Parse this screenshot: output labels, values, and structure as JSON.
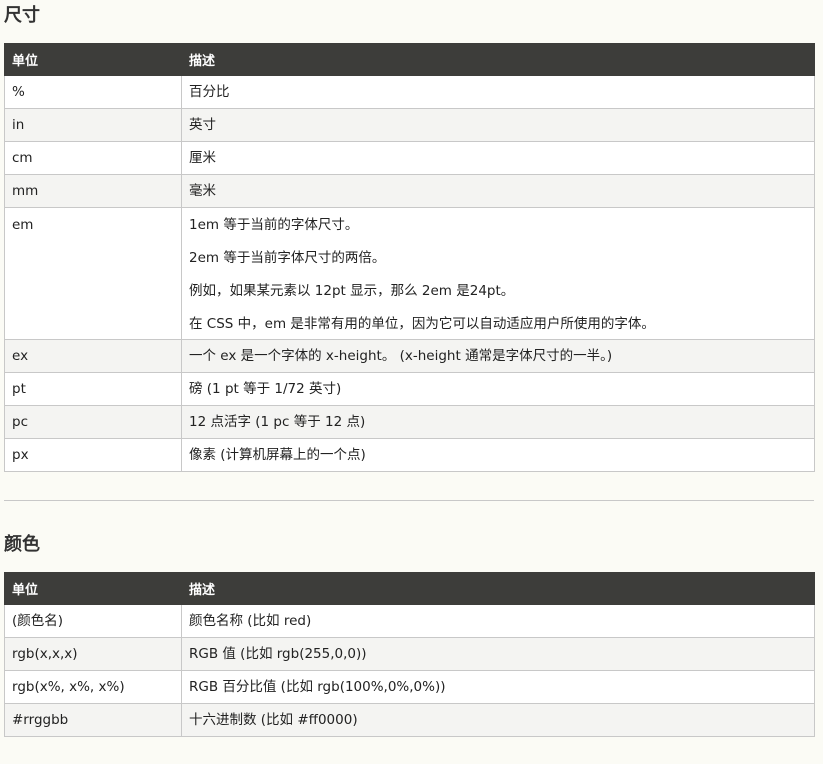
{
  "size_section": {
    "title": "尺寸",
    "headers": [
      "单位",
      "描述"
    ],
    "rows": [
      {
        "unit": "%",
        "desc": [
          "百分比"
        ]
      },
      {
        "unit": "in",
        "desc": [
          "英寸"
        ]
      },
      {
        "unit": "cm",
        "desc": [
          "厘米"
        ]
      },
      {
        "unit": "mm",
        "desc": [
          "毫米"
        ]
      },
      {
        "unit": "em",
        "desc": [
          "1em 等于当前的字体尺寸。",
          "2em 等于当前字体尺寸的两倍。",
          "例如，如果某元素以 12pt 显示，那么 2em 是24pt。",
          "在 CSS 中，em 是非常有用的单位，因为它可以自动适应用户所使用的字体。"
        ]
      },
      {
        "unit": "ex",
        "desc": [
          "一个 ex 是一个字体的 x-height。 (x-height 通常是字体尺寸的一半。)"
        ]
      },
      {
        "unit": "pt",
        "desc": [
          "磅 (1 pt 等于 1/72 英寸)"
        ]
      },
      {
        "unit": "pc",
        "desc": [
          "12 点活字 (1 pc 等于 12 点)"
        ]
      },
      {
        "unit": "px",
        "desc": [
          "像素 (计算机屏幕上的一个点)"
        ]
      }
    ]
  },
  "color_section": {
    "title": "颜色",
    "headers": [
      "单位",
      "描述"
    ],
    "rows": [
      {
        "unit": "(颜色名)",
        "desc": [
          "颜色名称 (比如 red)"
        ]
      },
      {
        "unit": "rgb(x,x,x)",
        "desc": [
          "RGB 值 (比如 rgb(255,0,0))"
        ]
      },
      {
        "unit": "rgb(x%, x%, x%)",
        "desc": [
          "RGB 百分比值 (比如 rgb(100%,0%,0%))"
        ]
      },
      {
        "unit": "#rrggbb",
        "desc": [
          "十六进制数 (比如 #ff0000)"
        ]
      }
    ]
  }
}
